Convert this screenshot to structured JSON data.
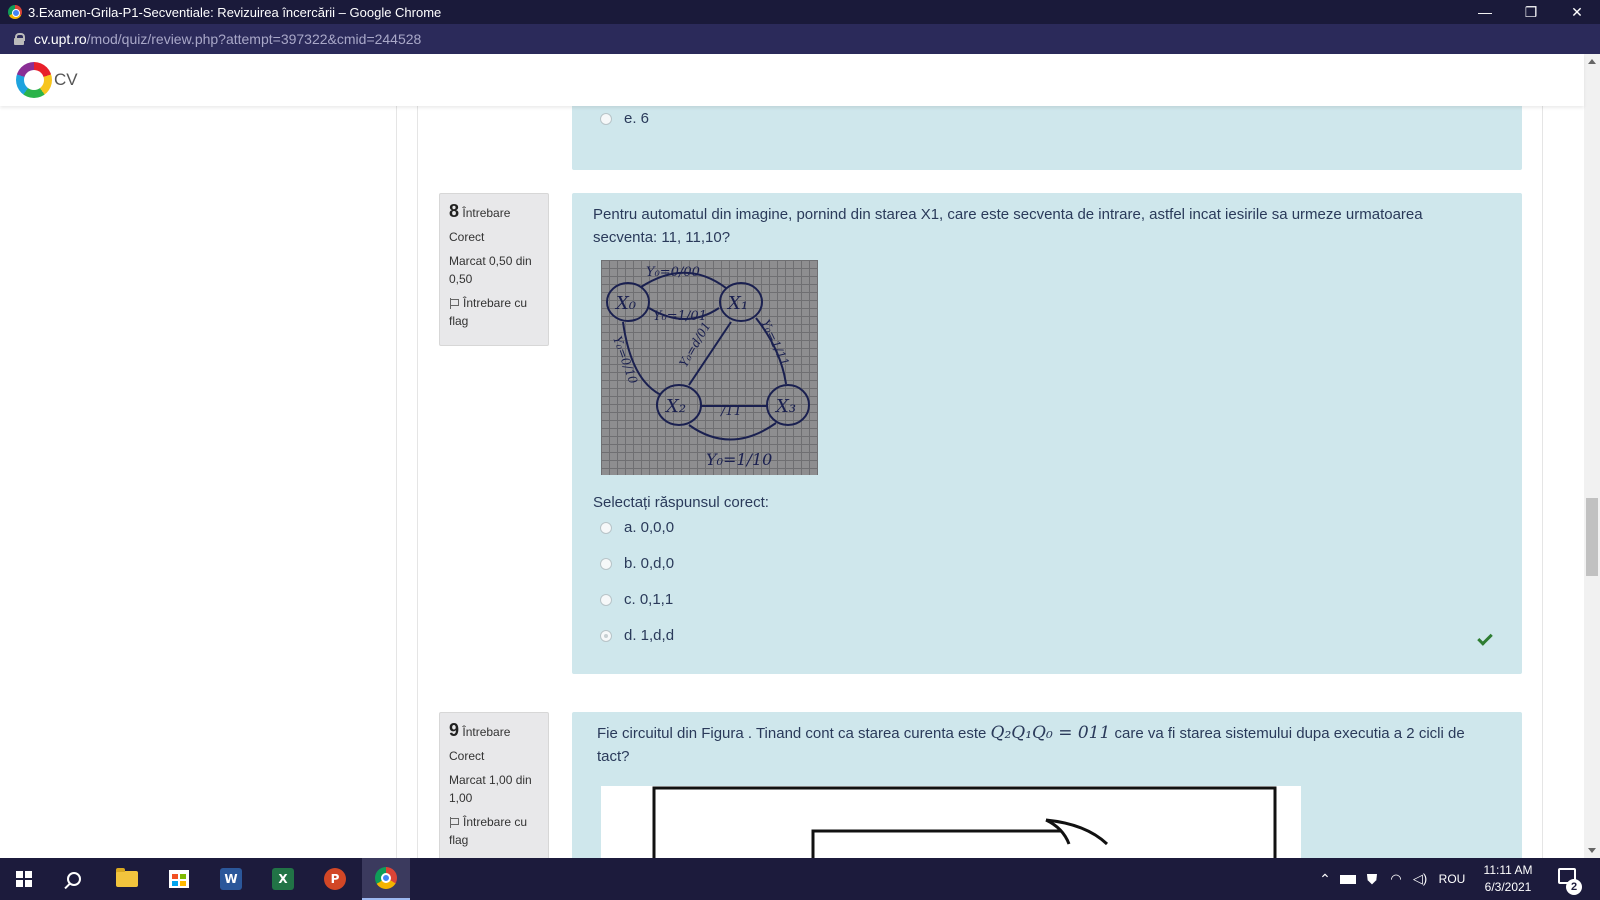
{
  "window": {
    "title": "3.Examen-Grila-P1-Secventiale: Revizuirea încercării – Google Chrome",
    "minimize": "—",
    "restore": "❐",
    "close": "✕"
  },
  "address": {
    "domain": "cv.upt.ro",
    "path": "/mod/quiz/review.php?attempt=397322&cmid=244528"
  },
  "site": {
    "logo_text": "CV"
  },
  "prev_question": {
    "last_option": "e. 6"
  },
  "question8": {
    "number": "8",
    "label": "Întrebare",
    "state": "Corect",
    "mark": "Marcat 0,50 din 0,50",
    "flag": "Întrebare cu flag",
    "text": "Pentru automatul din imagine, pornind din starea X1, care este secventa de intrare, astfel incat iesirile sa urmeze urmatoarea secventa: 11, 11,10?",
    "prompt": "Selectați răspunsul corect:",
    "options": [
      "a. 0,0,0",
      "b. 0,d,0",
      "c. 0,1,1",
      "d. 1,d,d"
    ],
    "selected_option": "d. 1,d,d",
    "diagram_labels": {
      "state_x0": "X₀",
      "state_x1": "X₁",
      "state_x2": "X₂",
      "state_x3": "X₃",
      "t_top": "Y₀=0/00",
      "t_mid": "Y₀=1/01",
      "t_left": "Y₀=0/10",
      "t_center": "Y₀=d/01",
      "t_right": "Y₀=1/11",
      "t_x3x2": "/11",
      "t_bottom": "Y₀=1/10"
    }
  },
  "question9": {
    "number": "9",
    "label": "Întrebare",
    "state": "Corect",
    "mark": "Marcat 1,00 din 1,00",
    "flag": "Întrebare cu flag",
    "text_before": "Fie circuitul din Figura . Tinand cont ca starea curenta este",
    "formula": "Q₂Q₁Q₀ = 011",
    "text_after": "care va fi starea sistemului dupa executia a 2 cicli de tact?"
  },
  "taskbar": {
    "tray_lang": "ROU",
    "time": "11:11 AM",
    "date": "6/3/2021",
    "notifications": "2",
    "word_letter": "W",
    "excel_letter": "X",
    "ppt_letter": "P"
  },
  "colors": {
    "title_bar": "#1a1a3a",
    "address_bar": "#2b2a5a",
    "question_bg": "#cfe7ec",
    "info_bg": "#e8e8ea",
    "correct": "#2e7d32"
  }
}
